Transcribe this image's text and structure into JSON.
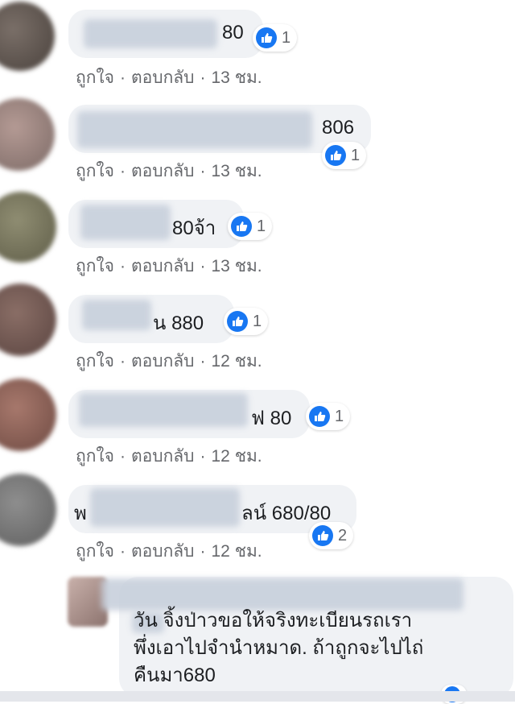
{
  "comments": [
    {
      "text": "80",
      "reactions": "1",
      "like_label": "ถูกใจ",
      "reply_label": "ตอบกลับ",
      "time": "13 ชม."
    },
    {
      "text": "806",
      "reactions": "1",
      "like_label": "ถูกใจ",
      "reply_label": "ตอบกลับ",
      "time": "13 ชม."
    },
    {
      "text": "80จ้า",
      "reactions": "1",
      "like_label": "ถูกใจ",
      "reply_label": "ตอบกลับ",
      "time": "13 ชม."
    },
    {
      "text": "น 880",
      "reactions": "1",
      "like_label": "ถูกใจ",
      "reply_label": "ตอบกลับ",
      "time": "12 ชม."
    },
    {
      "text": "ฟ 80",
      "reactions": "1",
      "like_label": "ถูกใจ",
      "reply_label": "ตอบกลับ",
      "time": "12 ชม."
    },
    {
      "text_prefix": "พ",
      "text": "ลน์ 680/80",
      "reactions": "2",
      "like_label": "ถูกใจ",
      "reply_label": "ตอบกลับ",
      "time": "12 ชม."
    }
  ],
  "last_comment": {
    "line1": "วัน จิ้งป่าวขอให้จริงทะเบียนรถเรา",
    "line2": "พึ่งเอาไปจำนำหมาด. ถ้าถูกจะไปไถ่",
    "line3": "คืนมา680"
  },
  "separator": "·",
  "colors": {
    "like_blue": "#1877f2",
    "bubble_bg": "#f0f2f5",
    "meta_gray": "#65676b"
  }
}
